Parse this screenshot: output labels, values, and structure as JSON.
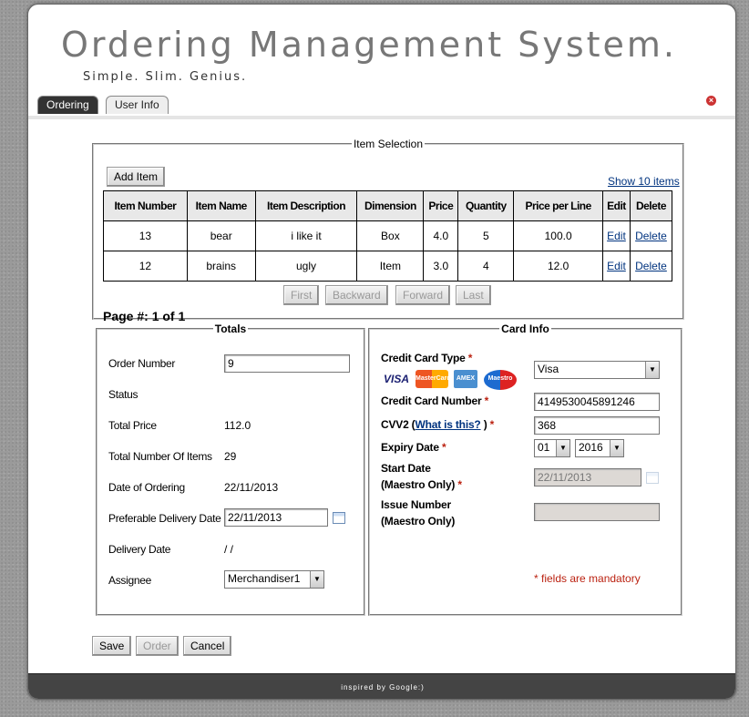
{
  "header": {
    "title": "Ordering Management System.",
    "subtitle": "Simple. Slim. Genius."
  },
  "tabs": [
    {
      "label": "Ordering",
      "active": true
    },
    {
      "label": "User Info",
      "active": false
    }
  ],
  "close_icon": "close-icon",
  "item_selection": {
    "legend": "Item Selection",
    "add_item_label": "Add Item",
    "show_link": "Show 10 items",
    "columns": [
      "Item Number",
      "Item Name",
      "Item Description",
      "Dimension",
      "Price",
      "Quantity",
      "Price per Line",
      "Edit",
      "Delete"
    ],
    "rows": [
      {
        "number": "13",
        "name": "bear",
        "description": "i like it",
        "dimension": "Box",
        "price": "4.0",
        "quantity": "5",
        "price_per_line": "100.0",
        "edit": "Edit",
        "delete": "Delete"
      },
      {
        "number": "12",
        "name": "brains",
        "description": "ugly",
        "dimension": "Item",
        "price": "3.0",
        "quantity": "4",
        "price_per_line": "12.0",
        "edit": "Edit",
        "delete": "Delete"
      }
    ],
    "pager": {
      "first": "First",
      "backward": "Backward",
      "forward": "Forward",
      "last": "Last"
    },
    "page_label": "Page #:",
    "page_value": "1 of 1"
  },
  "totals": {
    "legend": "Totals",
    "order_number_label": "Order Number",
    "order_number_value": "9",
    "status_label": "Status",
    "total_price_label": "Total Price",
    "total_price_value": "112.0",
    "total_items_label": "Total Number Of Items",
    "total_items_value": "29",
    "date_ordering_label": "Date of Ordering",
    "date_ordering_value": "22/11/2013",
    "pref_delivery_label": "Preferable Delivery Date",
    "pref_delivery_value": "22/11/2013",
    "delivery_date_label": "Delivery Date",
    "delivery_date_value": "/ /",
    "assignee_label": "Assignee",
    "assignee_value": "Merchandiser1"
  },
  "card_info": {
    "legend": "Card Info",
    "type_label": "Credit Card Type",
    "type_value": "Visa",
    "logos": [
      "VISA",
      "MasterCard",
      "AMEX",
      "Maestro"
    ],
    "number_label": "Credit Card Number",
    "number_value": "4149530045891246",
    "cvv_label_prefix": "CVV2 (",
    "cvv_link": "What is this?",
    "cvv_label_suffix": " )",
    "cvv_value": "368",
    "expiry_label": "Expiry Date",
    "expiry_month": "01",
    "expiry_year": "2016",
    "start_label_line1": "Start Date",
    "start_label_line2": "(Maestro Only)",
    "start_value": "22/11/2013",
    "issue_label_line1": "Issue Number",
    "issue_label_line2": "(Maestro Only)",
    "issue_value": "",
    "required_mark": "*",
    "mandatory_note": "* fields are mandatory"
  },
  "actions": {
    "save": "Save",
    "order": "Order",
    "cancel": "Cancel"
  },
  "footer": {
    "text": "inspired by Google:)"
  }
}
